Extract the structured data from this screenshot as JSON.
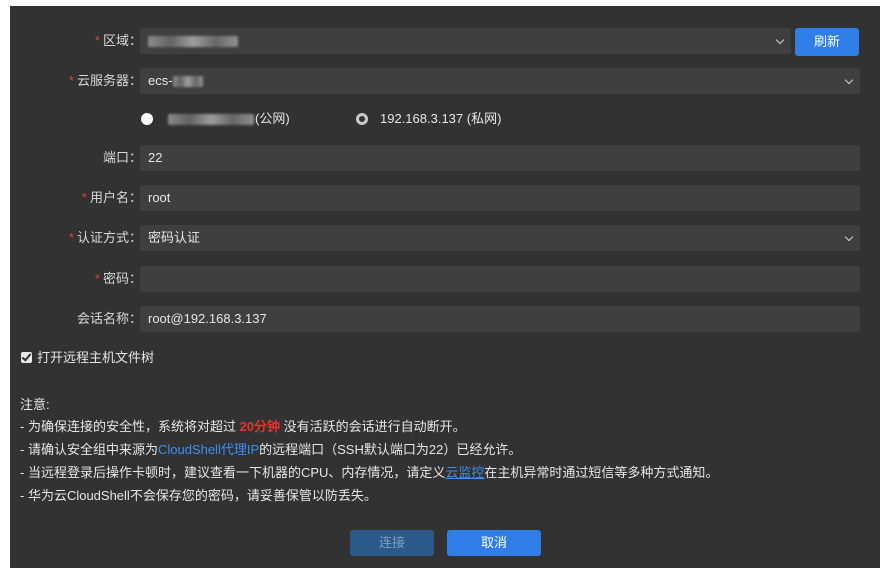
{
  "form": {
    "region": {
      "label": "区域：",
      "value_redacted": true,
      "refresh_label": "刷新"
    },
    "server": {
      "label": "云服务器：",
      "value_prefix": "ecs-"
    },
    "ip_options": {
      "public_suffix": "(公网)",
      "private": "192.168.3.137 (私网)"
    },
    "port": {
      "label": "端口：",
      "value": "22"
    },
    "username": {
      "label": "用户名：",
      "value": "root"
    },
    "auth": {
      "label": "认证方式：",
      "value": "密码认证"
    },
    "password": {
      "label": "密码：",
      "value": ""
    },
    "session": {
      "label": "会话名称：",
      "value": "root@192.168.3.137"
    },
    "open_tree": {
      "label": "打开远程主机文件树",
      "checked": true
    }
  },
  "notes": {
    "title": "注意:",
    "line1_a": "- 为确保连接的安全性，系统将对超过 ",
    "line1_hl": "20分钟",
    "line1_b": " 没有活跃的会话进行自动断开。",
    "line2_a": "- 请确认安全组中来源为",
    "line2_hl": "CloudShell代理IP",
    "line2_b": "的远程端口（SSH默认端口为22）已经允许。",
    "line3_a": "- 当远程登录后操作卡顿时，建议查看一下机器的CPU、内存情况，请定义",
    "line3_link": "云监控",
    "line3_b": "在主机异常时通过短信等多种方式通知。",
    "line4": "- 华为云CloudShell不会保存您的密码，请妥善保管以防丢失。"
  },
  "buttons": {
    "connect": "连接",
    "cancel": "取消"
  },
  "colors": {
    "panel": "#323232",
    "field": "#3f3f3f",
    "primary": "#2f7ee8",
    "required": "#e0403c",
    "accent_red": "#e8332c",
    "link": "#3a8ef6"
  }
}
